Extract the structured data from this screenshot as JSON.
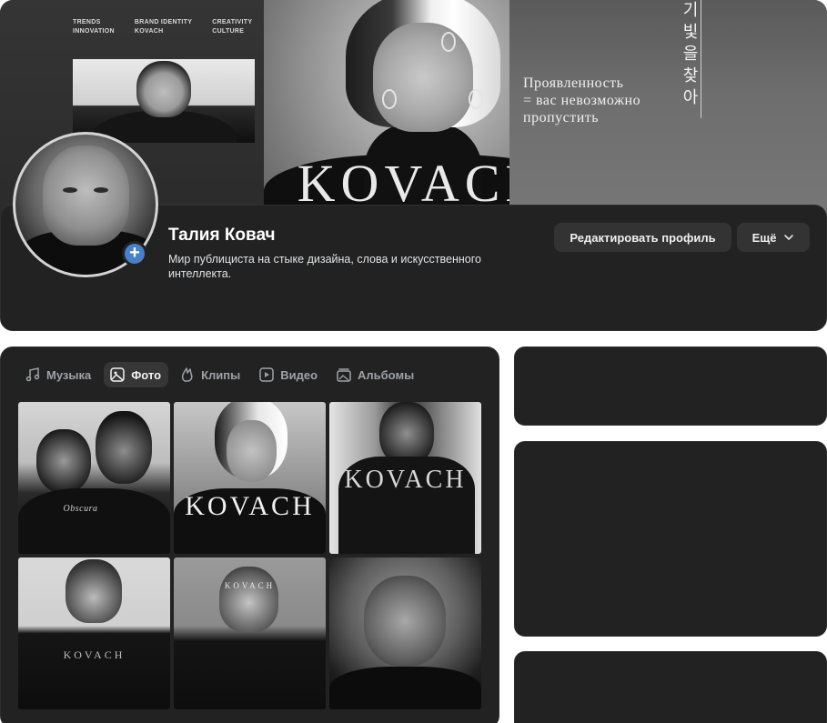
{
  "cover": {
    "tags": [
      "TRENDS\nINNOVATION",
      "BRAND IDENTITY\nKOVACH",
      "CREATIVITY\nCULTURE"
    ],
    "brand": "KOVACH",
    "slogan": "Проявленность\n= вас невозможно\nпропустить",
    "korean": "기 빛을 찾아"
  },
  "profile": {
    "name": "Талия Ковач",
    "bio": "Мир публициста на стыке дизайна, слова и искусственного интеллекта.",
    "edit_label": "Редактировать профиль",
    "more_label": "Ещё",
    "add_symbol": "+"
  },
  "tabs": [
    {
      "label": "Музыка",
      "icon": "music-note-icon",
      "active": false
    },
    {
      "label": "Фото",
      "icon": "photo-icon",
      "active": true
    },
    {
      "label": "Клипы",
      "icon": "clips-icon",
      "active": false
    },
    {
      "label": "Видео",
      "icon": "video-icon",
      "active": false
    },
    {
      "label": "Альбомы",
      "icon": "albums-icon",
      "active": false
    }
  ],
  "photos": {
    "tile2_label": "KOVACH",
    "tile3_label": "KOVACH",
    "tile4_label": "KOVACH",
    "tile5_label": "KOVACH",
    "tile1_caption": "Obscura"
  },
  "colors": {
    "background": "#ffffff",
    "card": "#222222",
    "button": "#333333",
    "accent": "#4a80c7"
  }
}
